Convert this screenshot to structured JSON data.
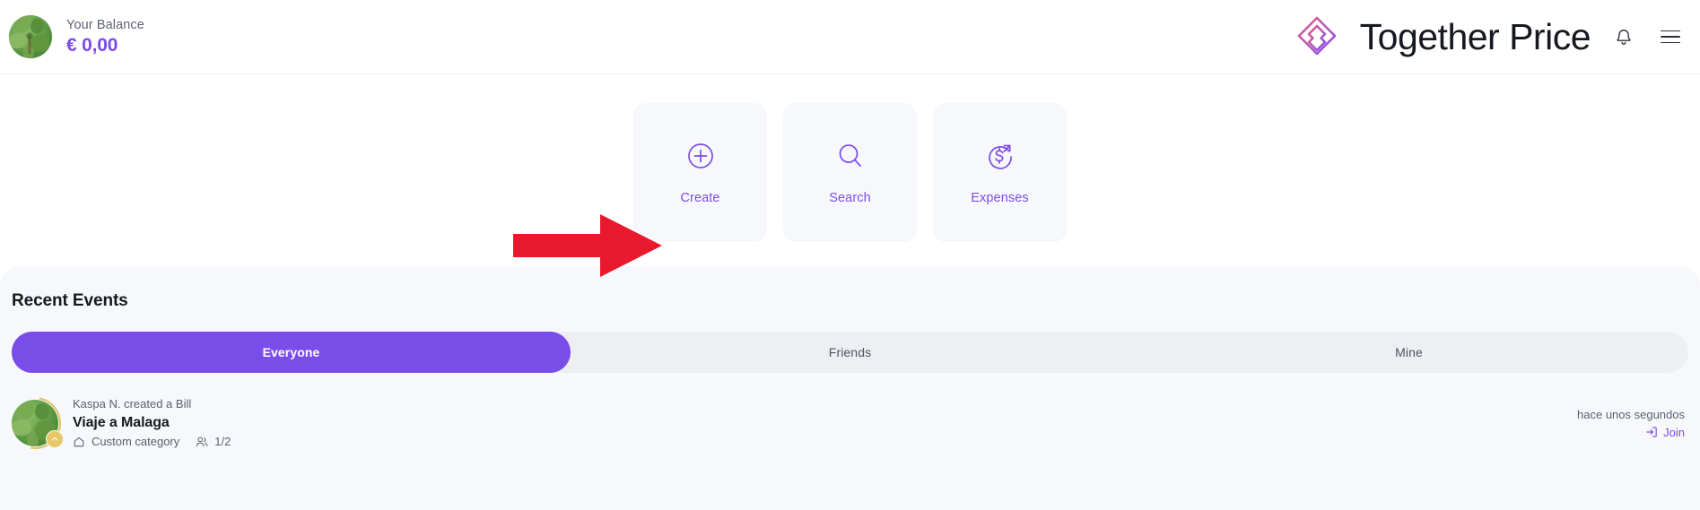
{
  "header": {
    "balance_label": "Your Balance",
    "balance_value": "€ 0,00",
    "brand_name": "Together Price",
    "avatar_name": "user-avatar",
    "bell_icon": "bell-icon",
    "menu_icon": "hamburger-menu-icon",
    "logo_icon": "together-price-logo",
    "accent_color": "#7b4de8",
    "logo_gradient_start": "#e05f8f",
    "logo_gradient_end": "#7b4de8"
  },
  "quick_actions": [
    {
      "label": "Create",
      "icon": "plus-circle-icon"
    },
    {
      "label": "Search",
      "icon": "magnifier-icon"
    },
    {
      "label": "Expenses",
      "icon": "dollar-circle-arrow-icon"
    }
  ],
  "annotation": {
    "type": "red-arrow",
    "color": "#e8192c",
    "points_to": "Create"
  },
  "recent_events": {
    "title": "Recent Events",
    "tabs": [
      {
        "label": "Everyone",
        "active": true
      },
      {
        "label": "Friends",
        "active": false
      },
      {
        "label": "Mine",
        "active": false
      }
    ],
    "items": [
      {
        "subtitle": "Kaspa N. created a Bill",
        "title": "Viaje a Malaga",
        "category": "Custom category",
        "category_icon": "house-icon",
        "members_icon": "people-icon",
        "members": "1/2",
        "time": "hace unos segundos",
        "action_label": "Join",
        "action_icon": "enter-arrow-icon"
      }
    ]
  }
}
